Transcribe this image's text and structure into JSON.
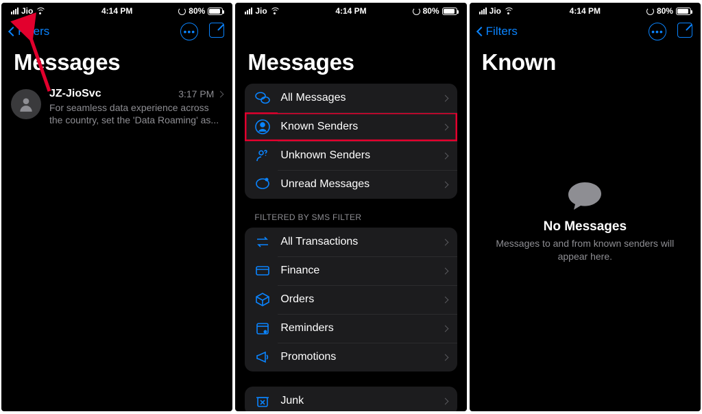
{
  "status": {
    "carrier": "Jio",
    "time": "4:14 PM",
    "battery_pct": "80%",
    "battery_fill": 80
  },
  "nav": {
    "back_label": "Filters"
  },
  "screen1": {
    "title": "Messages",
    "convo": {
      "name": "JZ-JioSvc",
      "time": "3:17 PM",
      "preview": "For seamless data experience across the country, set the 'Data Roaming' as..."
    }
  },
  "screen2": {
    "title": "Messages",
    "group_main": [
      {
        "id": "all",
        "label": "All Messages",
        "icon": "bubbles"
      },
      {
        "id": "known",
        "label": "Known Senders",
        "icon": "person",
        "highlight": true
      },
      {
        "id": "unknown",
        "label": "Unknown Senders",
        "icon": "person-q"
      },
      {
        "id": "unread",
        "label": "Unread Messages",
        "icon": "bubble-dot"
      }
    ],
    "section_label": "FILTERED BY SMS FILTER",
    "group_filtered": [
      {
        "id": "trans",
        "label": "All Transactions",
        "icon": "swap"
      },
      {
        "id": "finance",
        "label": "Finance",
        "icon": "card"
      },
      {
        "id": "orders",
        "label": "Orders",
        "icon": "box"
      },
      {
        "id": "reminders",
        "label": "Reminders",
        "icon": "calendar"
      },
      {
        "id": "promo",
        "label": "Promotions",
        "icon": "megaphone"
      }
    ],
    "group_junk": [
      {
        "id": "junk",
        "label": "Junk",
        "icon": "trash"
      }
    ]
  },
  "screen3": {
    "title": "Known",
    "empty_title": "No Messages",
    "empty_body": "Messages to and from known senders will appear here."
  }
}
